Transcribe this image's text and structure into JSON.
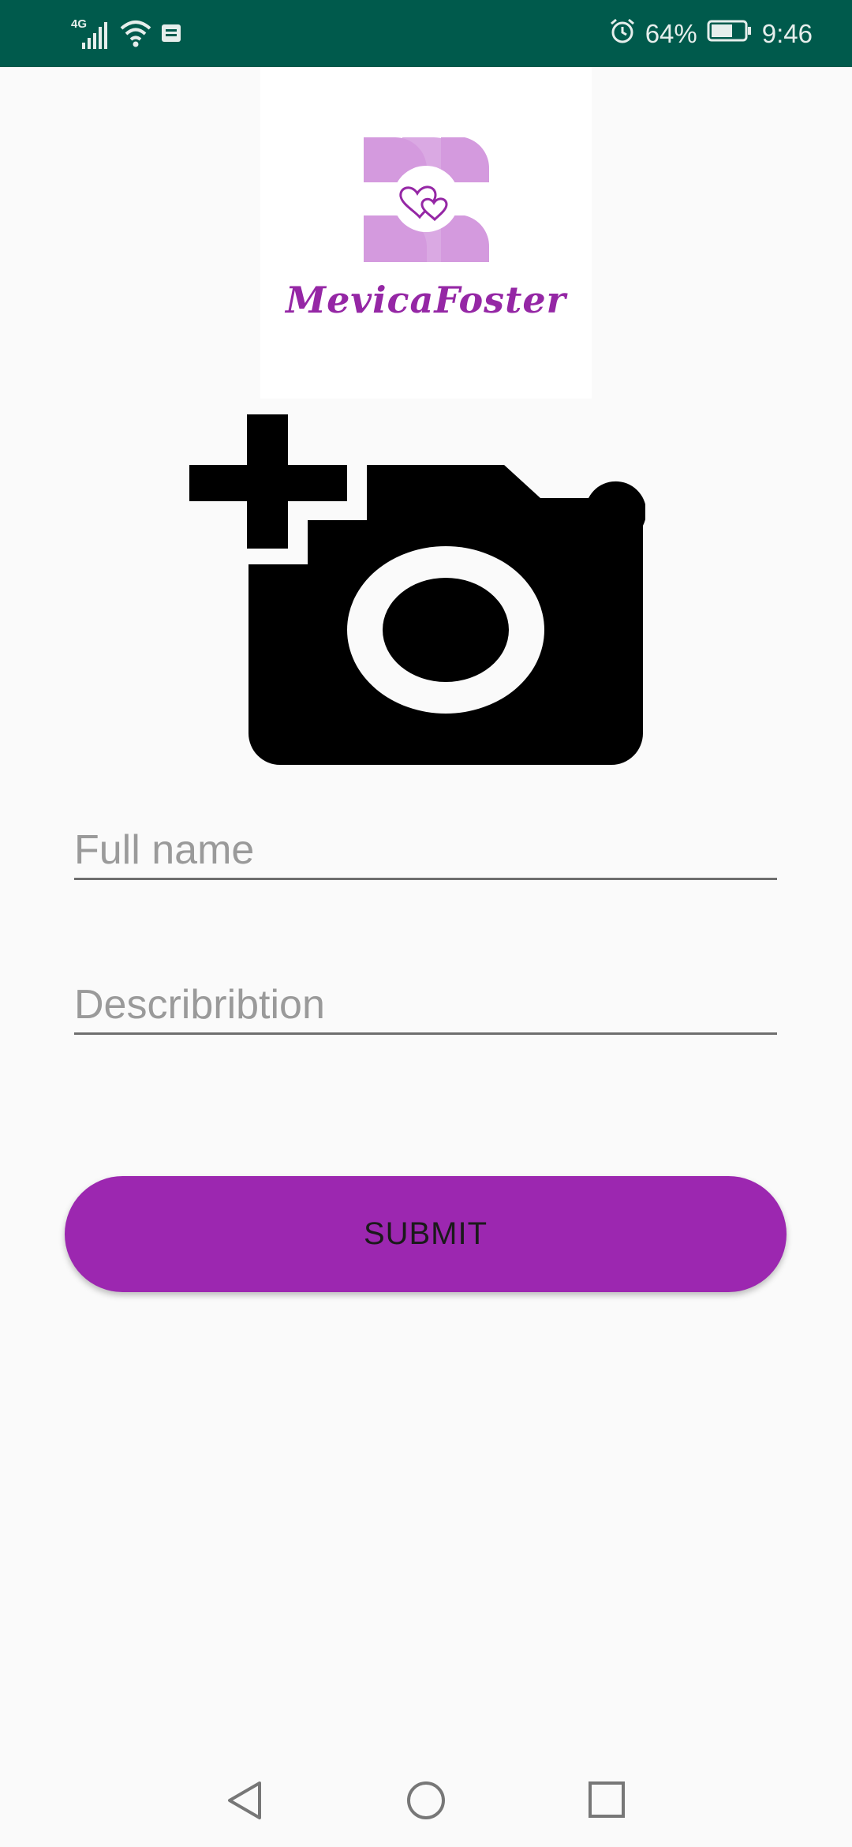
{
  "status_bar": {
    "network_type": "4G",
    "alarm_icon": "alarm-clock-icon",
    "battery_percent": "64%",
    "battery_level": 0.64,
    "time": "9:46"
  },
  "logo": {
    "brand_name": "MevicaFoster",
    "colors": {
      "primary": "#9527a5",
      "light": "#d49ade"
    }
  },
  "camera": {
    "icon": "add-a-photo-icon"
  },
  "form": {
    "full_name": {
      "placeholder": "Full name",
      "value": ""
    },
    "description": {
      "placeholder": "Describribtion",
      "value": ""
    },
    "submit_label": "SUBMIT"
  },
  "theme": {
    "accent": "#9c27b0",
    "status_bar": "#005a4c"
  },
  "nav_bar": {
    "back_icon": "back-triangle-icon",
    "home_icon": "home-circle-icon",
    "recents_icon": "recents-square-icon"
  }
}
